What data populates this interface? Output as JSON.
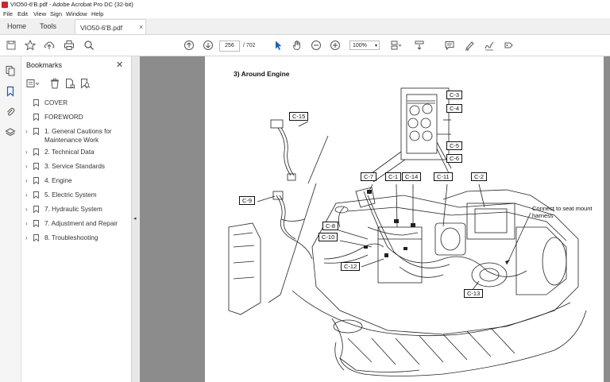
{
  "window": {
    "title": "VIO50-6'B.pdf - Adobe Acrobat Pro DC (32-bit)"
  },
  "menu": [
    "File",
    "Edit",
    "View",
    "Sign",
    "Window",
    "Help"
  ],
  "tabs": {
    "home": "Home",
    "tools": "Tools",
    "document": "VIO50-6'B.pdf",
    "close": "×"
  },
  "toolbar": {
    "page_current": "256",
    "page_total": "/ 702",
    "zoom": "100%"
  },
  "bookmarks": {
    "title": "Bookmarks",
    "close": "✕",
    "items": [
      {
        "label": "COVER",
        "expandable": false
      },
      {
        "label": "FOREWORD",
        "expandable": false
      },
      {
        "label": "1. General Cautions for Maintenance Work",
        "expandable": true
      },
      {
        "label": "2. Technical Data",
        "expandable": true
      },
      {
        "label": "3. Service Standards",
        "expandable": true
      },
      {
        "label": "4. Engine",
        "expandable": true
      },
      {
        "label": "5. Electric System",
        "expandable": true
      },
      {
        "label": "7. Hydraulic System",
        "expandable": true
      },
      {
        "label": "7. Adjustment and Repair",
        "expandable": true
      },
      {
        "label": "8. Troubleshooting",
        "expandable": true
      }
    ]
  },
  "document": {
    "heading": "3)  Around Engine",
    "callouts": [
      "C-3",
      "C-4",
      "C-5",
      "C-6",
      "C-15",
      "C-7",
      "C-1",
      "C-14",
      "C-11",
      "C-2",
      "C-9",
      "C-8",
      "C-10",
      "C-12",
      "C-13"
    ],
    "note": "Connect to seat mount harness"
  },
  "colors": {
    "accent": "#d8202a",
    "viewer_bg": "#8c8c8c",
    "icon": "#555555"
  }
}
